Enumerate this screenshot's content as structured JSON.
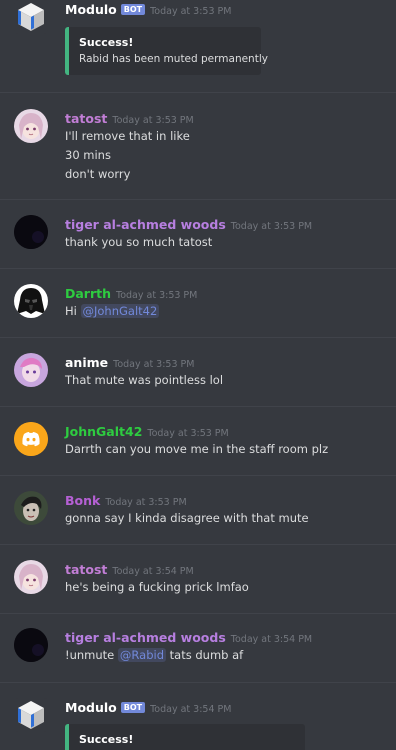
{
  "colors": {
    "background": "#36393f",
    "bot_tag": "#7289da",
    "embed_success": "#43b581",
    "timestamp": "#72767d",
    "mention": "#7289da"
  },
  "messages": [
    {
      "author": "Modulo",
      "author_color": "#ffffff",
      "bot_tag": "BOT",
      "timestamp": "Today at 3:53 PM",
      "avatar": "modulo-cube-icon",
      "embed": {
        "title": "Success!",
        "description": "Rabid has been muted permanently"
      }
    },
    {
      "author": "tatost",
      "author_color": "#c27ed6",
      "timestamp": "Today at 3:53 PM",
      "avatar": "anime-girl-avatar",
      "lines": [
        "I'll remove that in like",
        "30 mins",
        "don't worry"
      ]
    },
    {
      "author": "tiger al-achmed woods",
      "author_color": "#b77fe0",
      "timestamp": "Today at 3:53 PM",
      "avatar": "dark-avatar",
      "lines": [
        "thank you so much tatost"
      ]
    },
    {
      "author": "Darrth",
      "author_color": "#2ecc40",
      "timestamp": "Today at 3:53 PM",
      "avatar": "darth-vader-avatar",
      "lines": [
        {
          "prefix": "Hi ",
          "mention": "@JohnGalt42"
        }
      ]
    },
    {
      "author": "anime",
      "author_color": "#ffffff",
      "timestamp": "Today at 3:53 PM",
      "avatar": "anime-avatar",
      "lines": [
        "That mute was pointless lol"
      ]
    },
    {
      "author": "JohnGalt42",
      "author_color": "#2ecc40",
      "timestamp": "Today at 3:53 PM",
      "avatar": "discord-logo-icon",
      "lines": [
        "Darrth can you move me in the staff room plz"
      ]
    },
    {
      "author": "Bonk",
      "author_color": "#b560d4",
      "timestamp": "Today at 3:53 PM",
      "avatar": "bonk-avatar",
      "lines": [
        "gonna say I kinda disagree with that mute"
      ]
    },
    {
      "author": "tatost",
      "author_color": "#c27ed6",
      "timestamp": "Today at 3:54 PM",
      "avatar": "anime-girl-avatar",
      "lines": [
        "he's being a fucking prick lmfao"
      ]
    },
    {
      "author": "tiger al-achmed woods",
      "author_color": "#b77fe0",
      "timestamp": "Today at 3:54 PM",
      "avatar": "dark-avatar",
      "lines": [
        {
          "prefix": "!unmute ",
          "mention": "@Rabid",
          "suffix": " tats dumb af"
        }
      ]
    },
    {
      "author": "Modulo",
      "author_color": "#ffffff",
      "bot_tag": "BOT",
      "timestamp": "Today at 3:54 PM",
      "avatar": "modulo-cube-icon",
      "embed": {
        "title": "Success!"
      }
    }
  ]
}
